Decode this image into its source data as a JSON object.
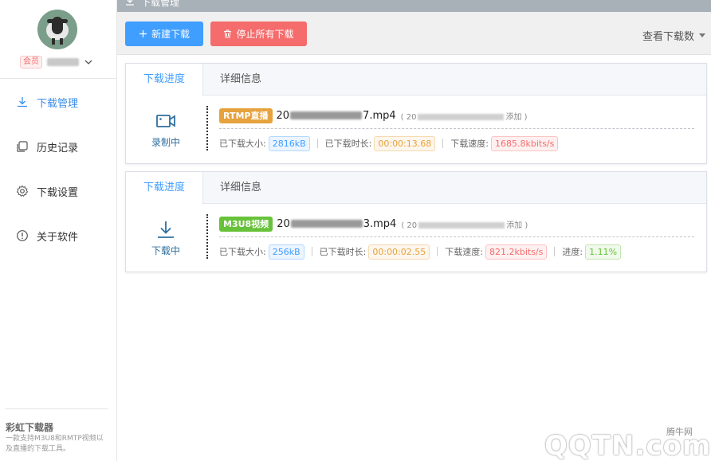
{
  "sidebar": {
    "member_badge": "会员",
    "nav": [
      {
        "label": "下载管理",
        "icon": "download-icon",
        "active": true
      },
      {
        "label": "历史记录",
        "icon": "history-icon",
        "active": false
      },
      {
        "label": "下载设置",
        "icon": "gear-icon",
        "active": false
      },
      {
        "label": "关于软件",
        "icon": "info-icon",
        "active": false
      }
    ],
    "app_name": "彩虹下载器",
    "app_desc": "一款支持M3U8和RMTP视频以及直播的下载工具。"
  },
  "topbar": {
    "title": "下载管理"
  },
  "toolbar": {
    "new_download": "新建下载",
    "stop_all": "停止所有下载",
    "view_count": "查看下载数"
  },
  "downloads": [
    {
      "tab_progress": "下载进度",
      "tab_detail": "详细信息",
      "state": "录制中",
      "state_icon": "video-camera-icon",
      "tag": "RTMP直播",
      "fname_prefix": "20",
      "fname_suffix": "7.mp4",
      "meta_open": "( 20",
      "meta_close": "添加 )",
      "stats": {
        "size_label": "已下载大小:",
        "size": "2816kB",
        "duration_label": "已下载时长:",
        "duration": "00:00:13.68",
        "speed_label": "下载速度:",
        "speed": "1685.8kbits/s"
      }
    },
    {
      "tab_progress": "下载进度",
      "tab_detail": "详细信息",
      "state": "下载中",
      "state_icon": "download-arrow-icon",
      "tag": "M3U8视频",
      "fname_prefix": "20",
      "fname_suffix": "3.mp4",
      "meta_open": "( 20",
      "meta_close": "添加 )",
      "stats": {
        "size_label": "已下载大小:",
        "size": "256kB",
        "duration_label": "已下载时长:",
        "duration": "00:00:02.55",
        "speed_label": "下载速度:",
        "speed": "821.2kbits/s",
        "progress_label": "进度:",
        "progress": "1.11%"
      }
    }
  ],
  "watermark": {
    "site": "腾牛网",
    "logo": "QQTN.com"
  },
  "colors": {
    "primary": "#409eff",
    "danger": "#f56c6c",
    "warning": "#e6a23c",
    "success": "#67c23a"
  }
}
